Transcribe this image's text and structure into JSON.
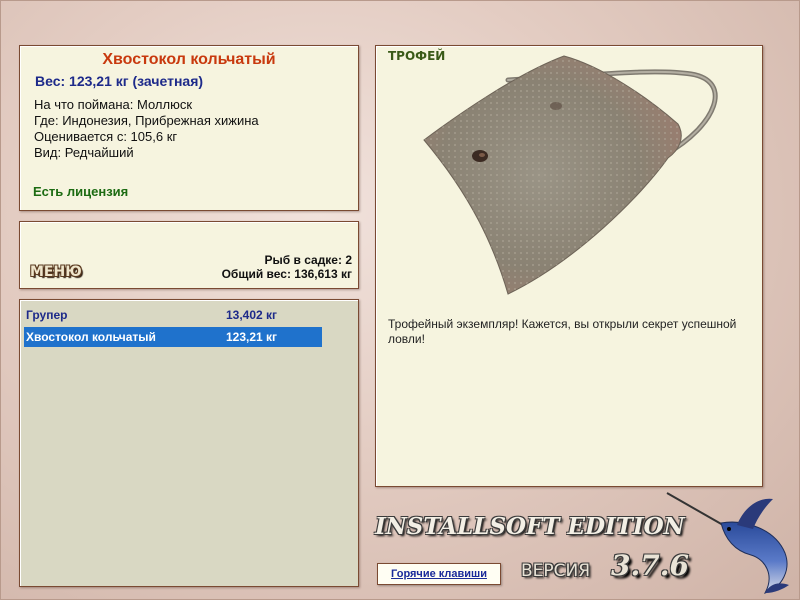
{
  "fish_info": {
    "title": "Хвостокол кольчатый",
    "weight": "Вес: 123,21 кг (зачетная)",
    "caught_on": "На что поймана: Моллюск",
    "location": "Где: Индонезия, Прибрежная хижина",
    "valued_from": "Оценивается с: 105,6 кг",
    "kind": "Вид: Редчайший",
    "license": "Есть лицензия"
  },
  "menu": {
    "label": "МЕНЮ",
    "fish_in_keepnet": "Рыб в садке: 2",
    "total_weight": "Общий вес: 136,613 кг"
  },
  "catch_list": [
    {
      "name": "Групер",
      "weight": "13,402 кг",
      "selected": false
    },
    {
      "name": "Хвостокол кольчатый",
      "weight": "123,21 кг",
      "selected": true
    }
  ],
  "trophy": {
    "label": "ТРОФЕЙ",
    "description": "Трофейный экземпляр! Кажется, вы открыли секрет успешной ловли!"
  },
  "footer": {
    "brand": "INSTALLSOFT EDITION",
    "version_label": "ВЕРСИЯ",
    "version_number": "3.7.6",
    "hotkeys": "Горячие клавиши"
  },
  "colors": {
    "title_red": "#c8390e",
    "weight_blue": "#1d2a8a",
    "license_green": "#1c6b12",
    "selection_blue": "#1f72cc",
    "panel_bg": "#f6f4df",
    "list_bg": "#d9d8c3"
  }
}
